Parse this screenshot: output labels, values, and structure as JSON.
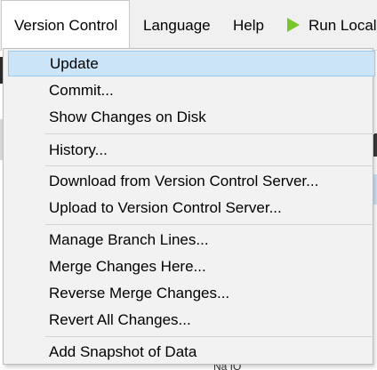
{
  "menubar": {
    "items": [
      {
        "label": "Version Control"
      },
      {
        "label": "Language"
      },
      {
        "label": "Help"
      },
      {
        "label": "Run Local"
      }
    ]
  },
  "dropdown": {
    "groups": [
      {
        "items": [
          {
            "label": "Update",
            "highlighted": true
          },
          {
            "label": "Commit..."
          },
          {
            "label": "Show Changes on Disk"
          }
        ]
      },
      {
        "items": [
          {
            "label": "History..."
          }
        ]
      },
      {
        "items": [
          {
            "label": "Download from Version Control Server..."
          },
          {
            "label": "Upload to Version Control Server..."
          }
        ]
      },
      {
        "items": [
          {
            "label": "Manage Branch Lines..."
          },
          {
            "label": "Merge Changes Here..."
          },
          {
            "label": "Reverse Merge Changes..."
          },
          {
            "label": "Revert All Changes..."
          }
        ]
      },
      {
        "items": [
          {
            "label": "Add Snapshot of Data"
          }
        ]
      }
    ]
  },
  "background": {
    "fragment_text": "Na IO"
  },
  "colors": {
    "highlight_fill": "#cce4f7",
    "highlight_border": "#99c9ef",
    "run_icon": "#79c62b"
  }
}
